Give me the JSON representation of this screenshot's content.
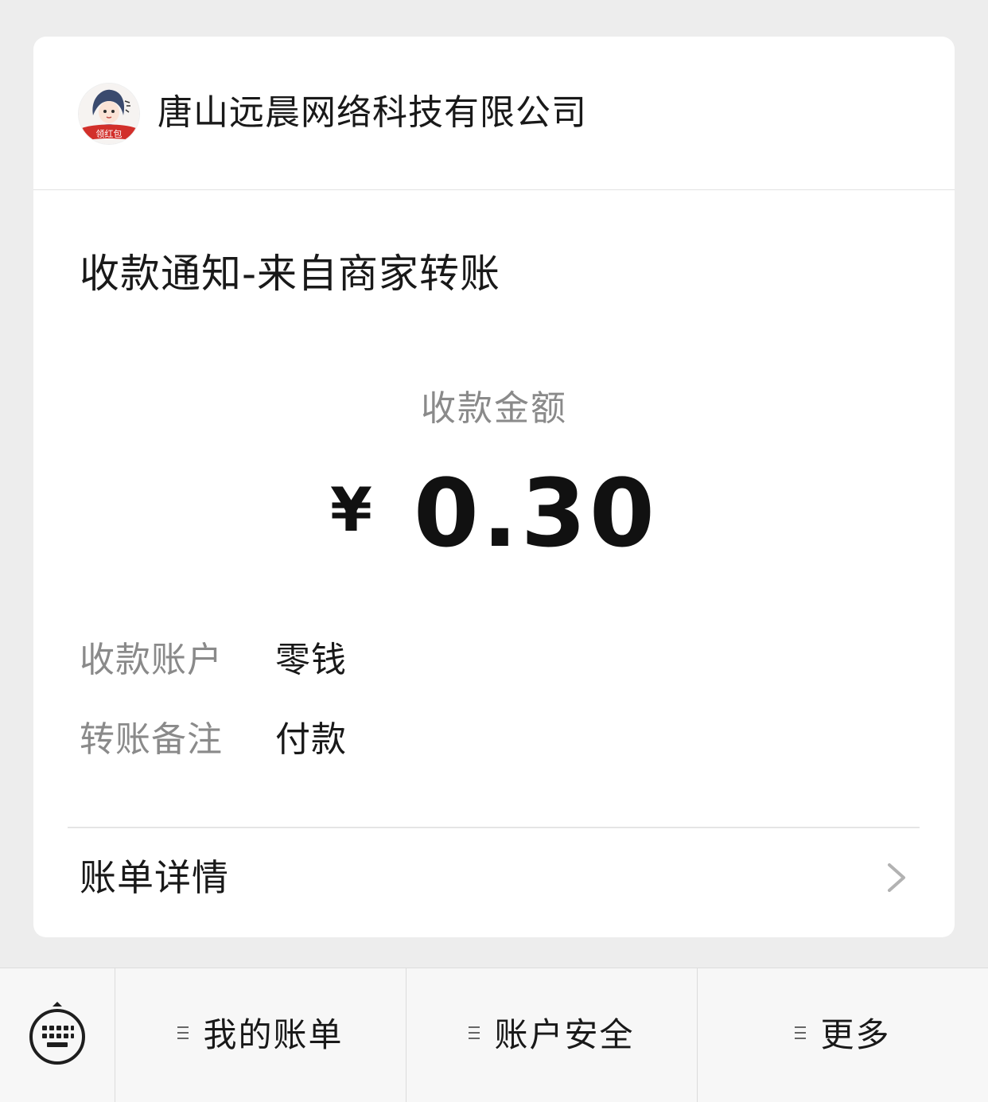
{
  "merchant": {
    "name": "唐山远晨网络科技有限公司",
    "avatar_icon": "merchant-avatar-icon",
    "avatar_caption": "领红包"
  },
  "notice": {
    "title": "收款通知-来自商家转账"
  },
  "amount": {
    "label": "收款金额",
    "currency": "¥",
    "value": "0.30"
  },
  "details": [
    {
      "label": "收款账户",
      "value": "零钱"
    },
    {
      "label": "转账备注",
      "value": "付款"
    }
  ],
  "bill_detail": {
    "label": "账单详情",
    "icon": "chevron-right-icon"
  },
  "bottom_menu": {
    "keyboard_icon": "keyboard-icon",
    "items": [
      {
        "label": "我的账单",
        "icon": "menu-lines-icon"
      },
      {
        "label": "账户安全",
        "icon": "menu-lines-icon"
      },
      {
        "label": "更多",
        "icon": "menu-lines-icon"
      }
    ]
  },
  "colors": {
    "page_background": "#ededed",
    "card_background": "#ffffff",
    "primary_text": "#191919",
    "secondary_text": "#8a8a8a",
    "accent_red": "#d22f2a"
  }
}
